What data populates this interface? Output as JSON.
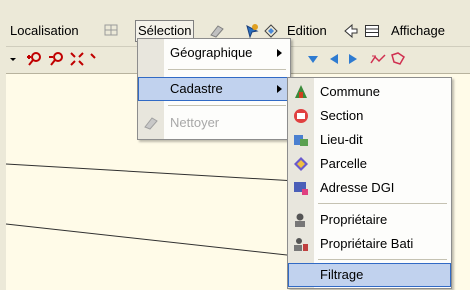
{
  "menubar": {
    "localisation": "Localisation",
    "selection": "Sélection",
    "edition": "Edition",
    "affichage": "Affichage"
  },
  "selection_menu": {
    "items": [
      {
        "label": "Géographique",
        "has_submenu": true,
        "enabled": true
      },
      {
        "label": "Cadastre",
        "has_submenu": true,
        "enabled": true,
        "highlighted": true
      },
      {
        "label": "Nettoyer",
        "has_submenu": false,
        "enabled": false
      }
    ]
  },
  "cadastre_menu": {
    "items": [
      {
        "label": "Commune",
        "icon": "commune-icon"
      },
      {
        "label": "Section",
        "icon": "section-icon"
      },
      {
        "label": "Lieu-dit",
        "icon": "lieu-dit-icon"
      },
      {
        "label": "Parcelle",
        "icon": "parcelle-icon"
      },
      {
        "label": "Adresse DGI",
        "icon": "adresse-icon"
      },
      {
        "label": "Propriétaire",
        "icon": "proprietaire-icon"
      },
      {
        "label": "Propriétaire Bati",
        "icon": "proprietaire-bati-icon"
      },
      {
        "label": "Filtrage",
        "icon": "",
        "highlighted": true
      }
    ]
  },
  "colors": {
    "menu_highlight": "#c1d2ee",
    "menu_highlight_border": "#316ac5",
    "map_background": "#fffbe8",
    "chrome": "#ece9d8"
  }
}
